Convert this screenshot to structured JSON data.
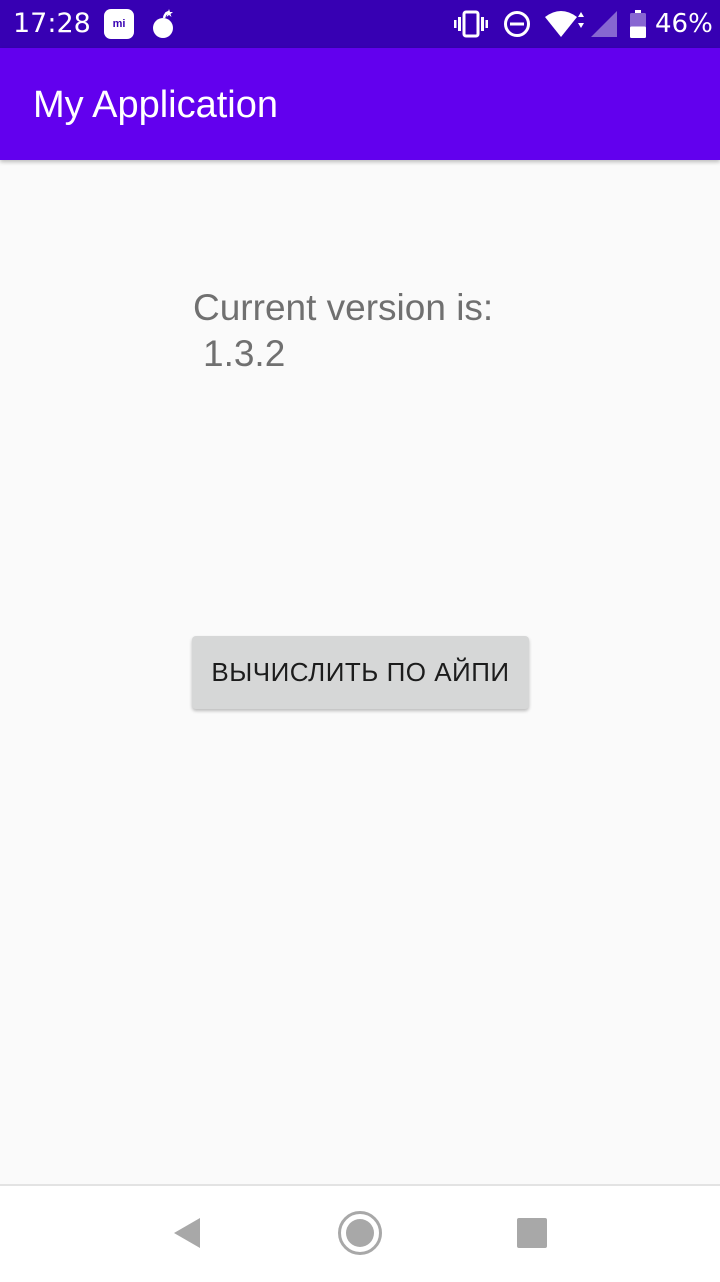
{
  "status_bar": {
    "time": "17:28",
    "mi_badge": "mi",
    "battery_percent": "46%",
    "battery_level": 0.46,
    "icons": [
      "mi-notification-icon",
      "bomb-icon",
      "vibrate-icon",
      "do-not-disturb-icon",
      "wifi-icon",
      "cell-signal-icon",
      "battery-icon"
    ]
  },
  "app_bar": {
    "title": "My Application",
    "color": "#6200ee"
  },
  "main": {
    "version_label": "Current version is:",
    "version_value": "1.3.2",
    "action_button_label": "ВЫЧИСЛИТЬ ПО АЙПИ"
  },
  "nav_bar": {
    "icons": [
      "back-icon",
      "home-icon",
      "recents-icon"
    ]
  },
  "colors": {
    "status_bar": "#3700b3",
    "app_bar": "#6200ee",
    "background": "#fafafa",
    "button": "#d6d7d7"
  }
}
